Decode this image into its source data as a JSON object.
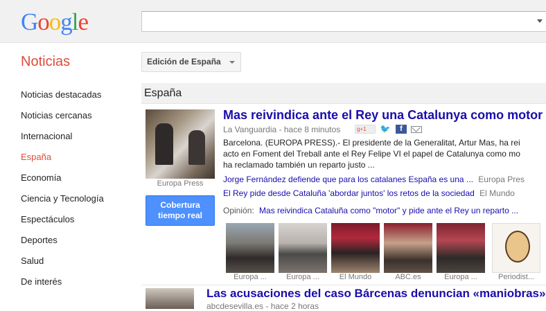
{
  "header": {
    "logo_text": "Google",
    "search": {
      "value": "",
      "placeholder": ""
    }
  },
  "brand": {
    "title": "Noticias"
  },
  "edition": {
    "label": "Edición de España"
  },
  "sidebar": {
    "items": [
      {
        "label": "Noticias destacadas",
        "active": false
      },
      {
        "label": "Noticias cercanas",
        "active": false
      },
      {
        "label": "Internacional",
        "active": false
      },
      {
        "label": "España",
        "active": true
      },
      {
        "label": "Economía",
        "active": false
      },
      {
        "label": "Ciencia y Tecnología",
        "active": false
      },
      {
        "label": "Espectáculos",
        "active": false
      },
      {
        "label": "Deportes",
        "active": false
      },
      {
        "label": "Salud",
        "active": false
      },
      {
        "label": "De interés",
        "active": false
      }
    ]
  },
  "section": {
    "title": "España"
  },
  "story1": {
    "image_caption": "Europa Press",
    "coverage_button": "Cobertura tiempo real",
    "headline": "Mas reivindica ante el Rey una Catalunya como motor",
    "source": "La Vanguardia",
    "time": "hace 8 minutos",
    "snippet_lines": [
      "Barcelona. (EUROPA PRESS).- El presidente de la Generalitat, Artur Mas, ha rei",
      "acto en Foment del Treball ante el Rey Felipe VI el papel de Catalunya como mo",
      "ha reclamado también un reparto justo ..."
    ],
    "related": [
      {
        "title": "Jorge Fernández defiende que para los catalanes España es una ...",
        "source": "Europa Pres"
      },
      {
        "title": "El Rey pide desde Cataluña 'abordar juntos' los retos de la sociedad",
        "source": "El Mundo"
      }
    ],
    "opinion": {
      "label": "Opinión:",
      "title": "Mas reivindica Cataluña como \"motor\" y pide ante el Rey un reparto ..."
    },
    "photos": [
      {
        "caption": "Europa ..."
      },
      {
        "caption": "Europa ..."
      },
      {
        "caption": "El Mundo"
      },
      {
        "caption": "ABC.es"
      },
      {
        "caption": "Europa ..."
      },
      {
        "caption": "Periodist..."
      }
    ]
  },
  "story2": {
    "headline": "Las acusaciones del caso Bárcenas denuncian «maniobras» par",
    "source": "abcdesevilla.es - hace 2 horas"
  },
  "icons": {
    "share": [
      "google-plus-icon",
      "twitter-icon",
      "facebook-icon",
      "mail-icon"
    ]
  },
  "colors": {
    "brand_red": "#dd4b39",
    "link_blue": "#1a0dab",
    "button_blue": "#4d90fe"
  }
}
